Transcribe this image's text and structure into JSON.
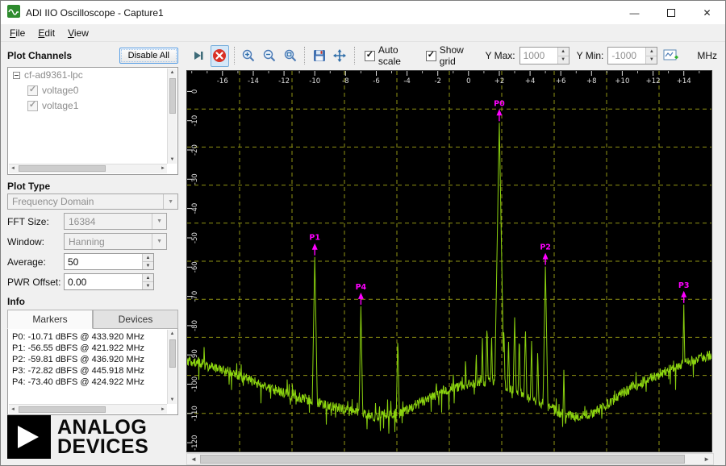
{
  "window": {
    "title": "ADI IIO Oscilloscope - Capture1",
    "controls": {
      "minimize": "—",
      "close": "✕"
    }
  },
  "menu": {
    "items": [
      {
        "label": "File"
      },
      {
        "label": "Edit"
      },
      {
        "label": "View"
      }
    ]
  },
  "left_panel": {
    "plot_channels": {
      "title": "Plot Channels",
      "disable_all_label": "Disable All",
      "tree": {
        "device": "cf-ad9361-lpc",
        "channels": [
          {
            "label": "voltage0",
            "checked": true
          },
          {
            "label": "voltage1",
            "checked": true
          }
        ]
      }
    },
    "plot_type": {
      "title": "Plot Type",
      "value": "Frequency Domain"
    },
    "fields": [
      {
        "label": "FFT Size:",
        "value": "16384",
        "type": "combo",
        "disabled": true
      },
      {
        "label": "Window:",
        "value": "Hanning",
        "type": "combo",
        "disabled": true
      },
      {
        "label": "Average:",
        "value": "50",
        "type": "spin",
        "disabled": false
      },
      {
        "label": "PWR Offset:",
        "value": "0.00",
        "type": "spin",
        "disabled": false
      }
    ],
    "info": {
      "title": "Info",
      "tabs": [
        {
          "label": "Markers",
          "active": true
        },
        {
          "label": "Devices",
          "active": false
        }
      ],
      "marker_lines": [
        "P0: -10.71 dBFS @ 433.920 MHz",
        "P1: -56.55 dBFS @ 421.922 MHz",
        "P2: -59.81 dBFS @ 436.920 MHz",
        "P3: -72.82 dBFS @ 445.918 MHz",
        "P4: -73.40 dBFS @ 424.922 MHz"
      ]
    },
    "logo": {
      "line1": "ANALOG",
      "line2": "DEVICES"
    }
  },
  "toolbar": {
    "icons": [
      "skip-forward-icon",
      "capture-stop-icon",
      "zoom-in-icon",
      "zoom-out-icon",
      "zoom-fit-icon",
      "save-icon",
      "pan-icon",
      "new-plot-icon"
    ],
    "auto_scale_label": "Auto scale",
    "auto_scale_checked": true,
    "show_grid_label": "Show grid",
    "show_grid_checked": true,
    "y_max_label": "Y Max:",
    "y_max_value": "1000",
    "y_min_label": "Y Min:",
    "y_min_value": "-1000",
    "unit_label": "MHz"
  },
  "chart_data": {
    "type": "line",
    "title": "",
    "x_unit": "MHz",
    "y_unit": "dBFS",
    "xlim": [
      -18.3,
      15.8
    ],
    "ylim": [
      -123,
      7
    ],
    "x_ticks": [
      -16,
      -14,
      -12,
      -10,
      -8,
      -6,
      -4,
      -2,
      0,
      2,
      4,
      6,
      8,
      10,
      12,
      14
    ],
    "y_ticks": [
      0,
      -10,
      -20,
      -30,
      -40,
      -50,
      -60,
      -70,
      -80,
      -90,
      -100,
      -110,
      -120
    ],
    "grid": true,
    "legend": false,
    "colors": {
      "background": "#000000",
      "grid": "#a9ad17",
      "trace": "#8bd30f",
      "marker": "#ff00ff",
      "tick_label": "#e0e0e0"
    },
    "markers": [
      {
        "label": "P0",
        "x": 2.0,
        "y": -10.71,
        "freq_mhz": 433.92
      },
      {
        "label": "P1",
        "x": -10.0,
        "y": -56.55,
        "freq_mhz": 421.922
      },
      {
        "label": "P2",
        "x": 5.0,
        "y": -59.81,
        "freq_mhz": 436.92
      },
      {
        "label": "P3",
        "x": 14.0,
        "y": -72.82,
        "freq_mhz": 445.918
      },
      {
        "label": "P4",
        "x": -7.0,
        "y": -73.4,
        "freq_mhz": 424.922
      }
    ],
    "noise_envelope": [
      [
        -18.3,
        -92
      ],
      [
        -16,
        -95
      ],
      [
        -14,
        -99
      ],
      [
        -12,
        -103
      ],
      [
        -10,
        -106
      ],
      [
        -8,
        -109
      ],
      [
        -6,
        -111
      ],
      [
        -4.5,
        -110
      ],
      [
        -3,
        -106
      ],
      [
        -1.5,
        -102
      ],
      [
        0,
        -100
      ],
      [
        1,
        -99
      ],
      [
        2,
        -100
      ],
      [
        3,
        -102
      ],
      [
        4,
        -105
      ],
      [
        5,
        -107
      ],
      [
        6,
        -110
      ],
      [
        7,
        -111
      ],
      [
        8,
        -110
      ],
      [
        9,
        -107
      ],
      [
        10,
        -103
      ],
      [
        11.5,
        -99
      ],
      [
        13,
        -95
      ],
      [
        14.5,
        -92
      ],
      [
        15.8,
        -90
      ]
    ],
    "spurs": [
      [
        -4.6,
        -84
      ],
      [
        -2.1,
        -97
      ],
      [
        -0.2,
        -92
      ],
      [
        0.5,
        -88
      ],
      [
        0.9,
        -84
      ],
      [
        1.2,
        -79
      ],
      [
        1.5,
        -83
      ],
      [
        1.8,
        -86
      ],
      [
        2.3,
        -80
      ],
      [
        2.6,
        -84
      ],
      [
        3.0,
        -77
      ],
      [
        3.3,
        -83
      ],
      [
        3.7,
        -80
      ],
      [
        4.1,
        -85
      ],
      [
        4.5,
        -88
      ],
      [
        6.2,
        -95
      ],
      [
        9.5,
        -101
      ]
    ]
  }
}
